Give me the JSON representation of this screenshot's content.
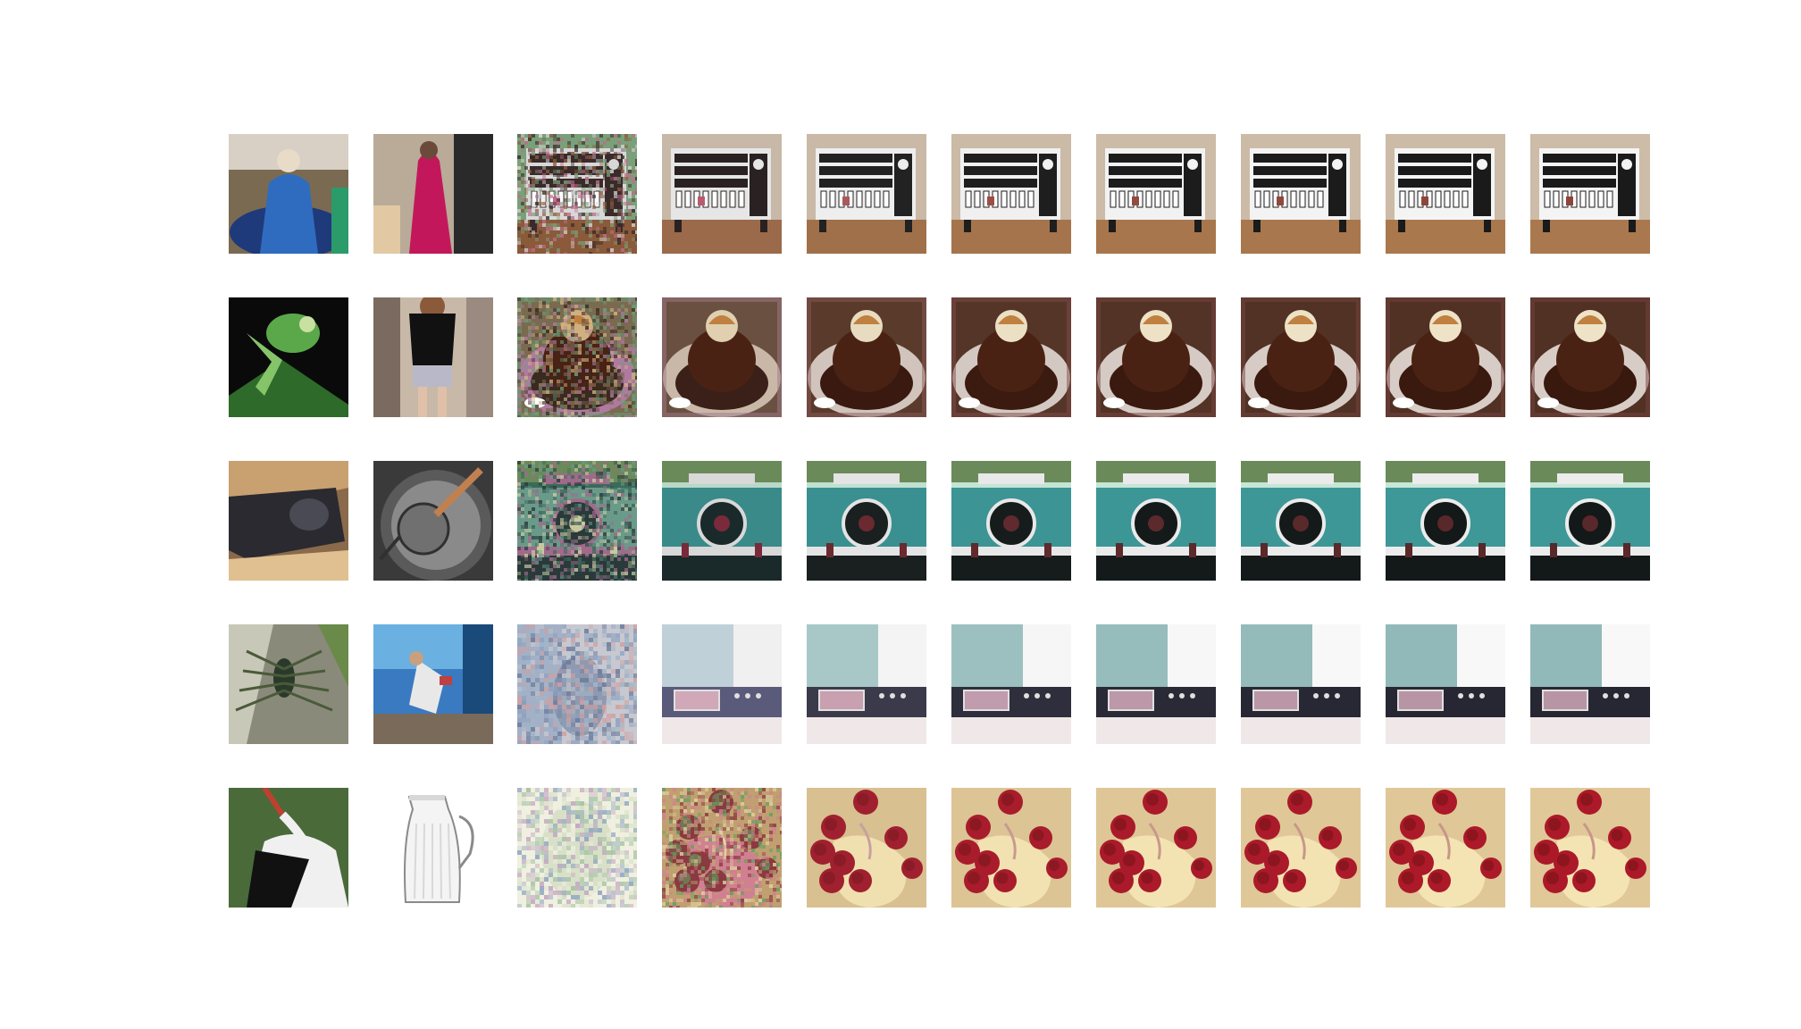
{
  "figure": {
    "rows": 5,
    "columns": 10,
    "background_color": "#ffffff",
    "grid": [
      [
        {
          "scene": "person-in-blue-robe",
          "palette": [
            "#7a6a52",
            "#1f3a7a",
            "#2f6cc0",
            "#2b9b6a",
            "#d8d0c4"
          ]
        },
        {
          "scene": "figure-in-red-costume",
          "palette": [
            "#b9ab98",
            "#c2185b",
            "#6b4a3a",
            "#2a2a2a",
            "#e2c9a4"
          ]
        },
        {
          "scene": "cabinet-noisy",
          "palette": [
            "#8a5a3a",
            "#d8d8d8",
            "#3a2a2a",
            "#c06a8a",
            "#7aa07a"
          ]
        },
        {
          "scene": "cabinet",
          "palette": [
            "#9a6a4a",
            "#e6e6e6",
            "#2a2222",
            "#b85a70",
            "#c8b8a8"
          ]
        },
        {
          "scene": "cabinet",
          "palette": [
            "#a0704a",
            "#eeeeee",
            "#222222",
            "#a85a5a",
            "#c9b9a6"
          ]
        },
        {
          "scene": "cabinet",
          "palette": [
            "#a5744c",
            "#f0f0f0",
            "#1e1e1e",
            "#9c4e46",
            "#cbbaa6"
          ]
        },
        {
          "scene": "cabinet",
          "palette": [
            "#a8764c",
            "#f2f2f2",
            "#1c1c1c",
            "#944a40",
            "#ccbba7"
          ]
        },
        {
          "scene": "cabinet",
          "palette": [
            "#a9774d",
            "#f3f3f3",
            "#1b1b1b",
            "#90483e",
            "#ccbba7"
          ]
        },
        {
          "scene": "cabinet",
          "palette": [
            "#aa784d",
            "#f4f4f4",
            "#1a1a1a",
            "#8e463c",
            "#ccbba7"
          ]
        },
        {
          "scene": "cabinet",
          "palette": [
            "#aa784e",
            "#f4f4f4",
            "#1a1a1a",
            "#8c453b",
            "#cdbca8"
          ]
        }
      ],
      [
        {
          "scene": "green-mantis",
          "palette": [
            "#0a0a0a",
            "#5aa84a",
            "#86c46a",
            "#2e6a2a",
            "#c8e0a0"
          ]
        },
        {
          "scene": "girl-black-shirt",
          "palette": [
            "#c8b8a8",
            "#111111",
            "#e0c0a8",
            "#9a8a80",
            "#7a6a60"
          ]
        },
        {
          "scene": "cake-noisy",
          "palette": [
            "#7a6a50",
            "#3a2a20",
            "#b07aa0",
            "#6aa07a",
            "#d0b080"
          ]
        },
        {
          "scene": "cake",
          "palette": [
            "#6a5040",
            "#3a2018",
            "#c9b8a8",
            "#a07a8a",
            "#e0d0b0"
          ]
        },
        {
          "scene": "cake",
          "palette": [
            "#5a3a2a",
            "#3a1a10",
            "#d0c4bc",
            "#8a5a5a",
            "#e8dcc0"
          ]
        },
        {
          "scene": "cake",
          "palette": [
            "#553528",
            "#3b1a10",
            "#d4c8c2",
            "#804c48",
            "#ece0c4"
          ]
        },
        {
          "scene": "cake",
          "palette": [
            "#523326",
            "#3a190f",
            "#d6cbc4",
            "#7a4642",
            "#eee2c6"
          ]
        },
        {
          "scene": "cake",
          "palette": [
            "#513225",
            "#3a190f",
            "#d7ccc5",
            "#784440",
            "#eee2c6"
          ]
        },
        {
          "scene": "cake",
          "palette": [
            "#503124",
            "#3a190f",
            "#d8cdc6",
            "#76423e",
            "#efe3c7"
          ]
        },
        {
          "scene": "cake",
          "palette": [
            "#503124",
            "#39180e",
            "#d8cdc6",
            "#75413d",
            "#efe3c7"
          ]
        }
      ],
      [
        {
          "scene": "black-cat",
          "palette": [
            "#8a6a4a",
            "#2a2a30",
            "#c9a070",
            "#4a4a55",
            "#e0c090"
          ]
        },
        {
          "scene": "pot-with-strainer",
          "palette": [
            "#3a3a3a",
            "#8a8a8a",
            "#5a5a5a",
            "#c08050",
            "#b0b0b0"
          ]
        },
        {
          "scene": "car-noisy",
          "palette": [
            "#2a3a3a",
            "#6a9a8a",
            "#a06a8a",
            "#c8c8a0",
            "#3a6a5a"
          ]
        },
        {
          "scene": "car",
          "palette": [
            "#1a2a2a",
            "#3a8a8a",
            "#d8d8d8",
            "#7a2a3a",
            "#b8d8c8"
          ]
        },
        {
          "scene": "car",
          "palette": [
            "#1a2020",
            "#3a9090",
            "#e4e4e4",
            "#6a2a30",
            "#c0e0d0"
          ]
        },
        {
          "scene": "car",
          "palette": [
            "#161c1c",
            "#3c9494",
            "#e8e8e8",
            "#602a2e",
            "#c4e4d4"
          ]
        },
        {
          "scene": "car",
          "palette": [
            "#141a1a",
            "#3d9696",
            "#eaeaea",
            "#5c2a2c",
            "#c6e6d6"
          ]
        },
        {
          "scene": "car",
          "palette": [
            "#141919",
            "#3e9797",
            "#ebebeb",
            "#5a292b",
            "#c6e6d6"
          ]
        },
        {
          "scene": "car",
          "palette": [
            "#131818",
            "#3e9898",
            "#ececec",
            "#58282a",
            "#c7e7d7"
          ]
        },
        {
          "scene": "car",
          "palette": [
            "#131818",
            "#3e9898",
            "#ececec",
            "#58282a",
            "#c7e7d7"
          ]
        }
      ],
      [
        {
          "scene": "spider-on-wood",
          "palette": [
            "#8a8a7a",
            "#2a3a2a",
            "#6a8a4a",
            "#c8c8b8",
            "#4a5a3a"
          ]
        },
        {
          "scene": "two-people-playing",
          "palette": [
            "#3a7ac0",
            "#e8e8e8",
            "#c04040",
            "#7a6a5a",
            "#6ab0e0"
          ]
        },
        {
          "scene": "blurry-person",
          "palette": [
            "#8aa0c0",
            "#c8c8d0",
            "#6a7a9a",
            "#d0a0a0",
            "#a0b8c8"
          ]
        },
        {
          "scene": "oven",
          "palette": [
            "#c0d0d8",
            "#f0f0f0",
            "#5a5a7a",
            "#d0a8b8",
            "#8aa8b0"
          ]
        },
        {
          "scene": "oven",
          "palette": [
            "#a8c8c8",
            "#f4f4f4",
            "#3a3a4a",
            "#c8a0b0",
            "#8ab0b0"
          ]
        },
        {
          "scene": "oven",
          "palette": [
            "#9cc0c0",
            "#f6f6f6",
            "#2e2e3c",
            "#c09cac",
            "#88b0b0"
          ]
        },
        {
          "scene": "oven",
          "palette": [
            "#96bcbc",
            "#f7f7f7",
            "#2a2a36",
            "#bc98a8",
            "#86afaf"
          ]
        },
        {
          "scene": "oven",
          "palette": [
            "#94baba",
            "#f8f8f8",
            "#282834",
            "#ba96a6",
            "#86afaf"
          ]
        },
        {
          "scene": "oven",
          "palette": [
            "#92b9b9",
            "#f8f8f8",
            "#272733",
            "#b895a5",
            "#85aeae"
          ]
        },
        {
          "scene": "oven",
          "palette": [
            "#92b9b9",
            "#f8f8f8",
            "#272733",
            "#b895a5",
            "#85aeae"
          ]
        }
      ],
      [
        {
          "scene": "stork",
          "palette": [
            "#4a6a3a",
            "#f0f0f0",
            "#111111",
            "#c04030",
            "#2a3a2a"
          ]
        },
        {
          "scene": "glass-pitcher",
          "palette": [
            "#ffffff",
            "#d8d8d8",
            "#8a8a8a",
            "#404040",
            "#f4f4f4"
          ]
        },
        {
          "scene": "pale-noisy",
          "palette": [
            "#d8e0c8",
            "#a0c0a0",
            "#c0a0c0",
            "#8aa0c0",
            "#f0f0e0"
          ]
        },
        {
          "scene": "strawberries-noisy",
          "palette": [
            "#c0a070",
            "#8a3a40",
            "#60a060",
            "#d08090",
            "#e0d0a0"
          ]
        },
        {
          "scene": "strawberries",
          "palette": [
            "#d8c090",
            "#a02030",
            "#7a1a20",
            "#f0e0b0",
            "#c8a0a0"
          ]
        },
        {
          "scene": "strawberries",
          "palette": [
            "#dcc494",
            "#a81c2c",
            "#7a161c",
            "#f2e2b2",
            "#c89a90"
          ]
        },
        {
          "scene": "strawberries",
          "palette": [
            "#dec696",
            "#aa1a2a",
            "#78141a",
            "#f3e3b3",
            "#c8988c"
          ]
        },
        {
          "scene": "strawberries",
          "palette": [
            "#dfc797",
            "#ab1a2a",
            "#781419",
            "#f3e3b3",
            "#c8978a"
          ]
        },
        {
          "scene": "strawberries",
          "palette": [
            "#dfc797",
            "#ac1929",
            "#771318",
            "#f4e4b4",
            "#c89689"
          ]
        },
        {
          "scene": "strawberries",
          "palette": [
            "#e0c898",
            "#ac1929",
            "#771318",
            "#f4e4b4",
            "#c89689"
          ]
        }
      ]
    ]
  }
}
